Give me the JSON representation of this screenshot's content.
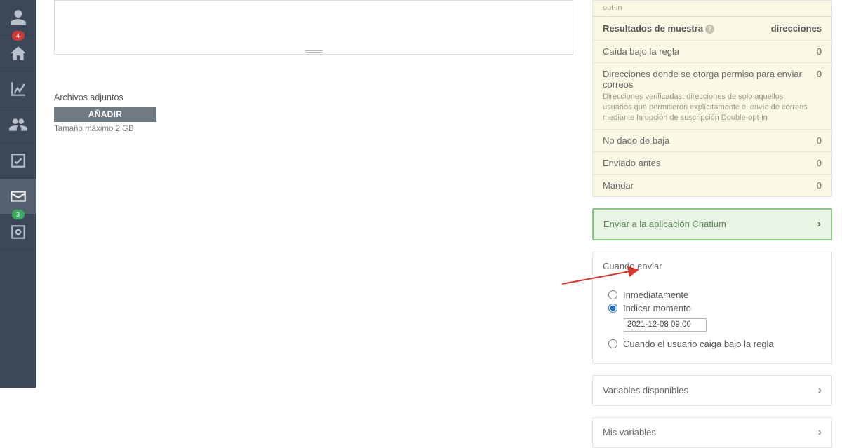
{
  "nav": {
    "badge_profile": "4",
    "badge_mail": "3"
  },
  "main": {
    "attachments_label": "Archivos adjuntos",
    "add_button": "AÑADIR",
    "size_hint": "Tamaño máximo 2 GB"
  },
  "results": {
    "top_note": "opt-in",
    "header_left": "Resultados de muestra",
    "header_right": "direcciones",
    "rows": [
      {
        "label": "Caída bajo la regla",
        "value": "0"
      },
      {
        "label": "Direcciones donde se otorga permiso para enviar correos",
        "desc": "Direcciones verificadas: direcciones de solo aquellos usuarios que permitieron explícitamente el envío de correos mediante la opción de suscripción Double-opt-in",
        "value": "0"
      },
      {
        "label": "No dado de baja",
        "value": "0"
      },
      {
        "label": "Enviado antes",
        "value": "0"
      },
      {
        "label": "Mandar",
        "value": "0"
      }
    ]
  },
  "chatium": {
    "label": "Enviar a la aplicación Chatium"
  },
  "schedule": {
    "header": "Cuando enviar",
    "opt_now": "Inmediatamente",
    "opt_at": "Indicar momento",
    "datetime": "2021-12-08 09:00",
    "opt_rule": "Cuando el usuario caiga bajo la regla"
  },
  "vars_available": {
    "label": "Variables disponibles"
  },
  "vars_mine": {
    "label": "Mis variables"
  }
}
